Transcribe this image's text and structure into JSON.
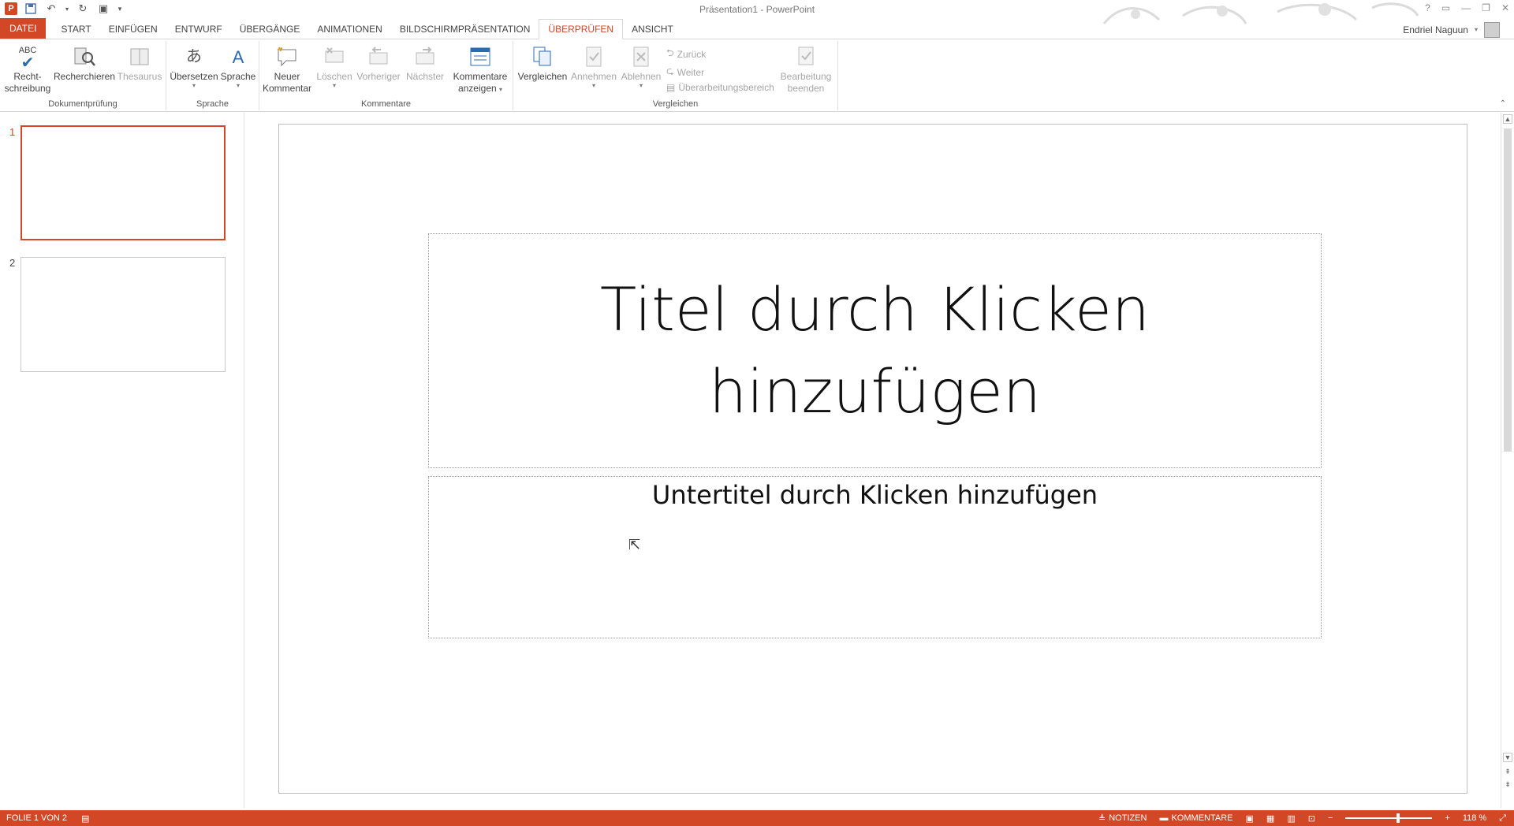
{
  "window": {
    "title": "Präsentation1 - PowerPoint"
  },
  "user": {
    "name": "Endriel Naguun"
  },
  "tabs": [
    {
      "label": "DATEI"
    },
    {
      "label": "START"
    },
    {
      "label": "EINFÜGEN"
    },
    {
      "label": "ENTWURF"
    },
    {
      "label": "ÜBERGÄNGE"
    },
    {
      "label": "ANIMATIONEN"
    },
    {
      "label": "BILDSCHIRMPRÄSENTATION"
    },
    {
      "label": "ÜBERPRÜFEN"
    },
    {
      "label": "ANSICHT"
    }
  ],
  "ribbon": {
    "proofing": {
      "label": "Dokumentprüfung",
      "spelling_line1": "Recht-",
      "spelling_line2": "schreibung",
      "spelling_icon_text": "ABC",
      "research": "Recherchieren",
      "thesaurus": "Thesaurus"
    },
    "language": {
      "label": "Sprache",
      "translate": "Übersetzen",
      "language": "Sprache"
    },
    "comments": {
      "label": "Kommentare",
      "new_line1": "Neuer",
      "new_line2": "Kommentar",
      "delete": "Löschen",
      "previous": "Vorheriger",
      "next": "Nächster",
      "show_line1": "Kommentare",
      "show_line2": "anzeigen"
    },
    "compare": {
      "label": "Vergleichen",
      "compare": "Vergleichen",
      "accept": "Annehmen",
      "reject": "Ablehnen",
      "back": "Zurück",
      "forward": "Weiter",
      "pane": "Überarbeitungsbereich",
      "end_line1": "Bearbeitung",
      "end_line2": "beenden"
    }
  },
  "slides": [
    {
      "number": "1"
    },
    {
      "number": "2"
    }
  ],
  "slide": {
    "title": "Titel durch Klicken hinzufügen",
    "subtitle": "Untertitel durch Klicken hinzufügen"
  },
  "status": {
    "slide_info": "FOLIE 1 VON 2",
    "notes": "NOTIZEN",
    "comments": "KOMMENTARE",
    "zoom": "118 %",
    "zoom_level": 0.59
  },
  "colors": {
    "accent": "#d24726"
  }
}
